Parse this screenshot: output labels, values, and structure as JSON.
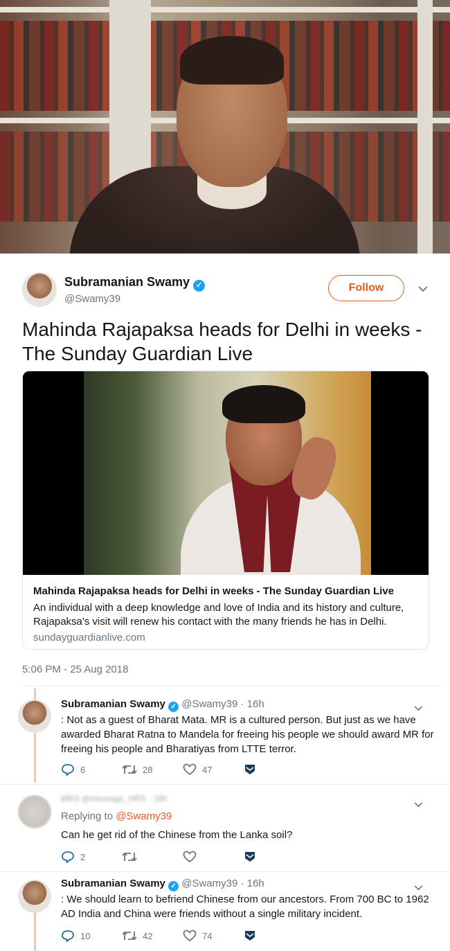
{
  "tweet": {
    "author_name": "Subramanian Swamy",
    "author_handle": "@Swamy39",
    "follow_label": "Follow",
    "text": "Mahinda Rajapaksa heads for Delhi in weeks - The Sunday Guardian Live",
    "timestamp": "5:06 PM - 25 Aug 2018"
  },
  "card": {
    "title": "Mahinda Rajapaksa heads for Delhi in weeks - The Sunday Guardian Live",
    "description": "An individual with a deep knowledge and love of India and its history and culture, Rajapaksa's visit will renew his contact with the many friends he has in Delhi.",
    "url": "sundayguardianlive.com"
  },
  "replies": [
    {
      "name": "Subramanian Swamy",
      "handle": "@Swamy39",
      "time": "· 16h",
      "text": ": Not as a guest of Bharat Mata. MR is a cultured person. But just as we have awarded Bharat Ratna to Mandela for freeing his people we should award MR for freeing his people and Bharatiyas from LTTE terror.",
      "replies": "6",
      "retweets": "28",
      "likes": "47"
    },
    {
      "name": "MRS",
      "handle": "@message_HRS",
      "time": "· 16h",
      "replying_prefix": "Replying to",
      "replying_to": "@Swamy39",
      "text": "Can he get rid of the Chinese from the Lanka soil?",
      "replies": "2",
      "retweets": "",
      "likes": ""
    },
    {
      "name": "Subramanian Swamy",
      "handle": "@Swamy39",
      "time": "· 16h",
      "text": ": We should learn to befriend Chinese from our ancestors. From 700 BC to 1962 AD India and China were friends without a single military incident.",
      "replies": "10",
      "retweets": "42",
      "likes": "74"
    }
  ],
  "icons": {
    "verified": "verified-badge-icon",
    "chevron": "chevron-down-icon",
    "reply": "reply-icon",
    "retweet": "retweet-icon",
    "like": "heart-icon",
    "dm": "direct-message-icon"
  },
  "colors": {
    "accent": "#e65c20",
    "verified": "#1da1f2",
    "muted": "#657786",
    "thread": "#f7c4a8"
  }
}
